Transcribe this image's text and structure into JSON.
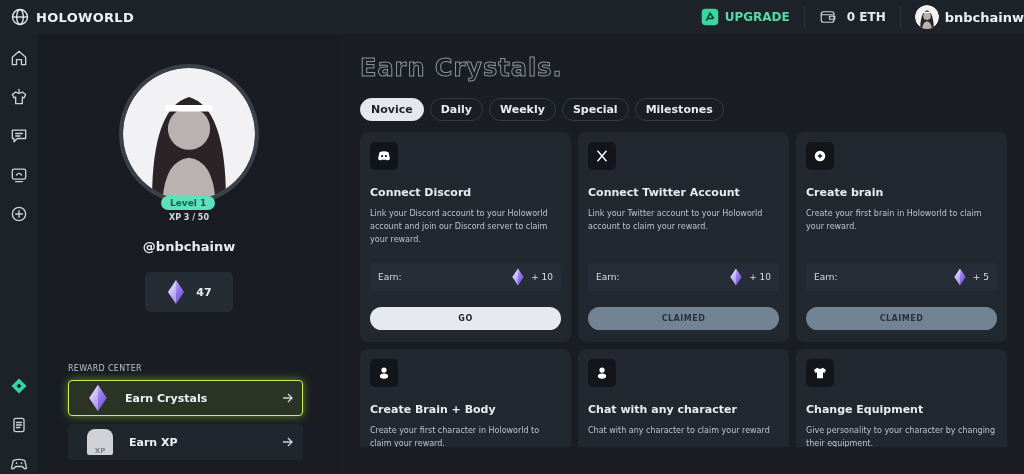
{
  "topbar": {
    "logo": "HOLOWORLD",
    "upgrade": "UPGRADE",
    "balance": "0 ETH",
    "user": "bnbchainw"
  },
  "rail": {
    "top": [
      {
        "kind": "home"
      },
      {
        "kind": "shirt"
      },
      {
        "kind": "chat"
      },
      {
        "kind": "monitor"
      },
      {
        "kind": "plus"
      }
    ],
    "bottom": [
      {
        "kind": "diamond"
      },
      {
        "kind": "document"
      },
      {
        "kind": "gamepad"
      }
    ]
  },
  "profile": {
    "level": "Level 1",
    "xp": "XP 3 / 50",
    "username": "@bnbchainw",
    "crystals": "47"
  },
  "reward_center": {
    "title": "REWARD CENTER",
    "items": [
      {
        "kind": "crystal",
        "label": "Earn Crystals",
        "selected": true
      },
      {
        "kind": "xp",
        "badge": "XP",
        "label": "Earn XP",
        "selected": false
      }
    ]
  },
  "heading": "Earn Crystals.",
  "tabs": [
    {
      "label": "Novice",
      "selected": true
    },
    {
      "label": "Daily",
      "selected": false
    },
    {
      "label": "Weekly",
      "selected": false
    },
    {
      "label": "Special",
      "selected": false
    },
    {
      "label": "Milestones",
      "selected": false
    }
  ],
  "tasks": [
    {
      "kind": "discord",
      "title": "Connect Discord",
      "description": "Link your Discord account to your Holoworld account and join our Discord server to claim your reward.",
      "earn_label": "Earn:",
      "reward": "+ 10",
      "button": "GO",
      "claimed": false
    },
    {
      "kind": "x",
      "title": "Connect Twitter Account",
      "description": "Link your Twitter account to your Holoworld account to claim your reward.",
      "earn_label": "Earn:",
      "reward": "+ 10",
      "button": "CLAIMED",
      "claimed": true
    },
    {
      "kind": "plus",
      "title": "Create brain",
      "description": "Create your first brain in Holoworld to claim your reward.",
      "earn_label": "Earn:",
      "reward": "+ 5",
      "button": "CLAIMED",
      "claimed": true
    },
    {
      "kind": "person",
      "title": "Create Brain + Body",
      "description": "Create your first character in Holoworld to claim your reward."
    },
    {
      "kind": "person",
      "title": "Chat with any character",
      "description": "Chat with any character to claim your reward"
    },
    {
      "kind": "shirt",
      "title": "Change Equipment",
      "description": "Give personality to your character by changing their equipment."
    }
  ]
}
